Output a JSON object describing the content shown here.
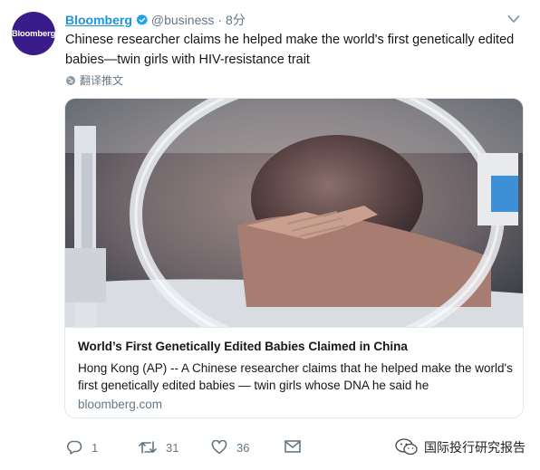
{
  "tweet": {
    "avatar_text": "Bloomberg",
    "account_name": "Bloomberg",
    "handle": "@business",
    "separator": "·",
    "time": "8分",
    "text": "Chinese researcher claims he helped make the world's first genetically edited babies—twin girls with HIV-resistance trait",
    "translate_label": "翻译推文"
  },
  "card": {
    "image_icon": "newborn-baby-incubator-photo",
    "title": "World’s First Genetically Edited Babies Claimed in China",
    "description": "Hong Kong (AP) -- A Chinese researcher claims that he helped make the world's first genetically edited babies — twin girls whose DNA he said he",
    "domain": "bloomberg.com"
  },
  "actions": {
    "reply_count": "1",
    "retweet_count": "31",
    "like_count": "36"
  },
  "watermark": {
    "text": "国际投行研究报告"
  },
  "colors": {
    "link": "#1b95e0",
    "muted": "#657786",
    "avatar_bg": "#3a1b8a"
  }
}
